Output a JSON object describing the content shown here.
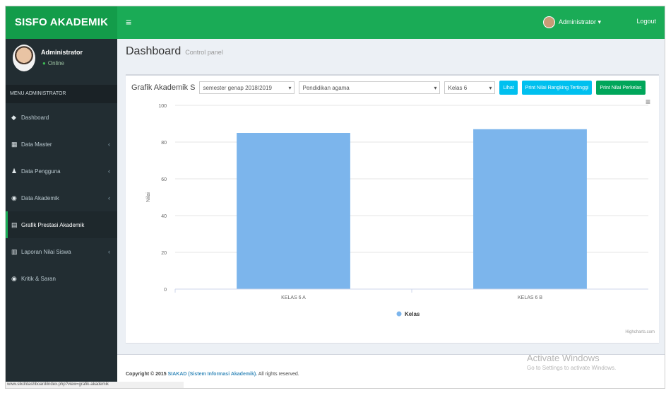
{
  "app": {
    "brand": "SISFO AKADEMIK",
    "toggle_icon": "≡",
    "user_name": "Administrator",
    "user_menu": "Administrator ▾",
    "user_status": "Online",
    "logout_label": "Logout"
  },
  "sidebar": {
    "menu_header": "MENU ADMINISTRATOR",
    "items": [
      {
        "label": "Dashboard",
        "icon": "dashboard-icon",
        "glyph": "◆",
        "has_children": false,
        "active": false
      },
      {
        "label": "Data Master",
        "icon": "grid-icon",
        "glyph": "▦",
        "has_children": true,
        "active": false
      },
      {
        "label": "Data Pengguna",
        "icon": "user-icon",
        "glyph": "♟",
        "has_children": true,
        "active": false
      },
      {
        "label": "Data Akademik",
        "icon": "tag-icon",
        "glyph": "◉",
        "has_children": true,
        "active": false
      },
      {
        "label": "Grafik Prestasi Akademik",
        "icon": "chart-icon",
        "glyph": "▤",
        "has_children": false,
        "active": true
      },
      {
        "label": "Laporan Nilai Siswa",
        "icon": "report-icon",
        "glyph": "▥",
        "has_children": true,
        "active": false
      },
      {
        "label": "Kritik & Saran",
        "icon": "comment-icon",
        "glyph": "◉",
        "has_children": false,
        "active": false
      }
    ]
  },
  "content": {
    "title": "Dashboard",
    "subtitle": "Control panel",
    "filter_label": "Grafik Akademik S",
    "semester_select": "semester genap 2018/2019",
    "subject_select": "Pendidikan agama",
    "class_select": "Kelas 6",
    "btn_lihat": "Lihat",
    "btn_rangking": "Print Nilai Rangking Tertinggi",
    "btn_perkelas": "Print Nilai Perkelas",
    "chart_menu_icon": "≡",
    "credits": "Highcharts.com"
  },
  "chart_data": {
    "type": "bar",
    "categories": [
      "KELAS 6 A",
      "KELAS 6 B"
    ],
    "series": [
      {
        "name": "Kelas",
        "values": [
          85,
          87
        ],
        "color": "#7cb5ec"
      }
    ],
    "ylabel": "Nilai",
    "ylim": [
      0,
      100
    ],
    "yticks": [
      0,
      20,
      40,
      60,
      80,
      100
    ],
    "grid": true,
    "legend": "bottom-center"
  },
  "footer": {
    "copyright": "Copyright © 2015",
    "link": "SIAKAD (Sistem Informasi Akademik).",
    "rights": "All rights reserved."
  },
  "watermark": {
    "line1": "Activate Windows",
    "line2": "Go to Settings to activate Windows."
  },
  "statusbar": "www.sikd/dashboard/index.php?view=grafik-akademik"
}
